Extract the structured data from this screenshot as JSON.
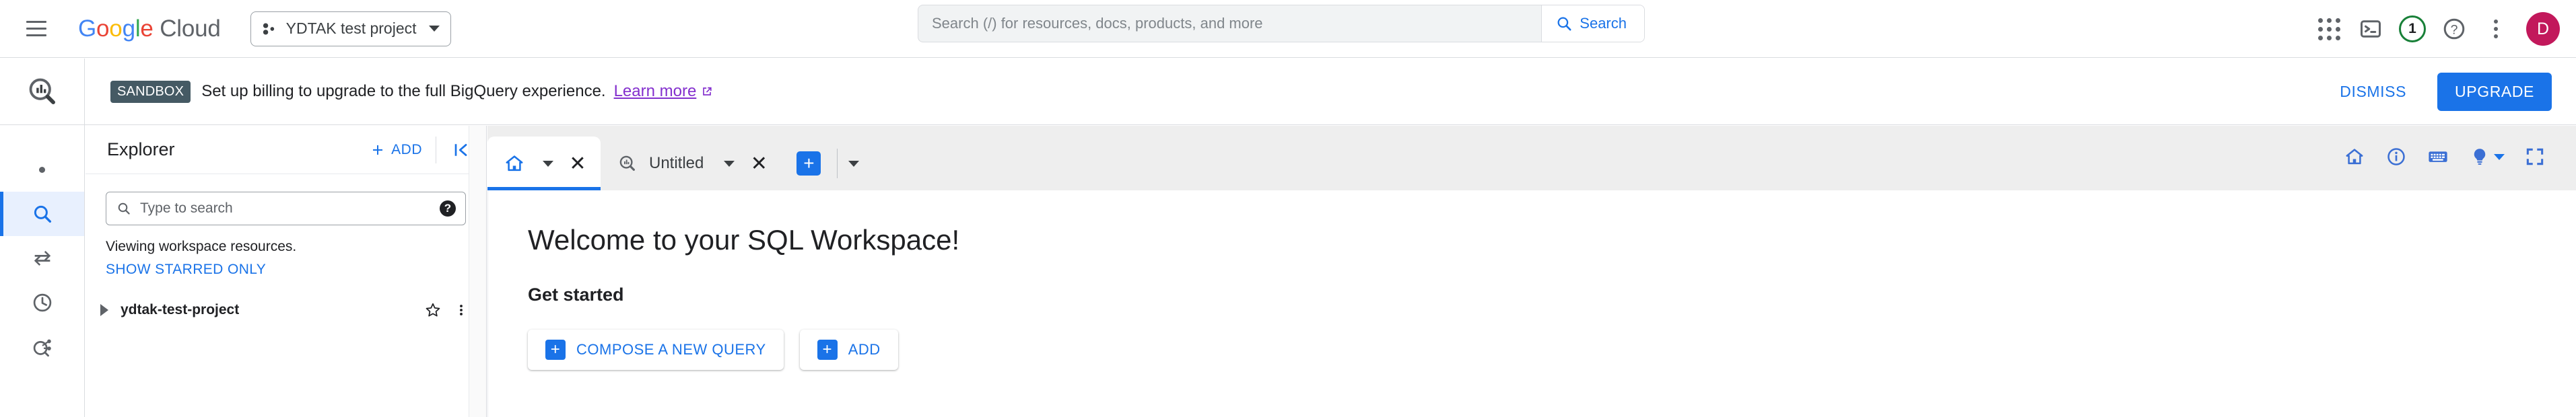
{
  "header": {
    "menu_icon": "hamburger-icon",
    "logo": {
      "google": "Google",
      "cloud": "Cloud"
    },
    "project_selector": {
      "label": "YDTAK test project",
      "icon": "project-nodes-icon",
      "caret": "chevron-down-icon"
    },
    "search": {
      "placeholder": "Search (/) for resources, docs, products, and more",
      "value": "",
      "button_label": "Search",
      "button_icon": "search-icon"
    },
    "icons": [
      {
        "name": "apps-grid-icon",
        "label": "Google apps"
      },
      {
        "name": "cloud-shell-icon",
        "label": "Activate Cloud Shell"
      },
      {
        "name": "notifications-badge-icon",
        "label": "1",
        "color": "#188038"
      },
      {
        "name": "help-icon",
        "label": "Help"
      },
      {
        "name": "more-options-icon",
        "label": "More options"
      }
    ],
    "avatar": {
      "initial": "D",
      "color": "#c2185b"
    }
  },
  "sandbox_bar": {
    "badge": "SANDBOX",
    "message": "Set up billing to upgrade to the full BigQuery experience.",
    "link_label": "Learn more",
    "link_icon": "external-link-icon",
    "dismiss_label": "DISMISS",
    "upgrade_label": "UPGRADE",
    "badge_color": "#455a64",
    "link_color": "#8430ce",
    "accent_color": "#1a73e8"
  },
  "left_rail": {
    "product_icon": "bigquery-logo-icon",
    "items": [
      {
        "name": "rail-item-dot",
        "icon": "dot-icon",
        "active": false
      },
      {
        "name": "rail-item-search",
        "icon": "search-icon",
        "active": true
      },
      {
        "name": "rail-item-transfers",
        "icon": "data-transfer-icon",
        "active": false
      },
      {
        "name": "rail-item-history",
        "icon": "clock-history-icon",
        "active": false
      },
      {
        "name": "rail-item-scheduled-queries",
        "icon": "scheduled-queries-icon",
        "active": false
      }
    ]
  },
  "explorer": {
    "title": "Explorer",
    "add_label": "ADD",
    "add_icon": "plus-icon",
    "collapse_icon": "collapse-panel-icon",
    "search": {
      "placeholder": "Type to search",
      "value": "",
      "icon": "search-icon",
      "help_icon": "help-icon"
    },
    "note": "Viewing workspace resources.",
    "starred_label": "SHOW STARRED ONLY",
    "tree": [
      {
        "label": "ydtak-test-project",
        "expand_icon": "triangle-right-icon",
        "star_icon": "star-outline-icon",
        "menu_icon": "more-vert-icon"
      }
    ]
  },
  "main": {
    "tabs": [
      {
        "name": "tab-home",
        "icon": "home-icon",
        "label": "",
        "active": true,
        "caret": "chevron-down-icon",
        "close": "close-icon"
      },
      {
        "name": "tab-untitled-query",
        "icon": "bigquery-logo-icon",
        "label": "Untitled",
        "active": false,
        "caret": "chevron-down-icon",
        "close": "close-icon"
      }
    ],
    "add_tab": {
      "icon": "plus-icon",
      "caret": "chevron-down-icon"
    },
    "toolbar_icons": [
      {
        "name": "toolbar-home-icon",
        "icon": "home-icon"
      },
      {
        "name": "toolbar-info-icon",
        "icon": "info-circle-icon"
      },
      {
        "name": "toolbar-keyboard-shortcuts-icon",
        "icon": "keyboard-icon"
      },
      {
        "name": "toolbar-tips-icon",
        "icon": "lightbulb-icon",
        "has_caret": true
      },
      {
        "name": "toolbar-fullscreen-icon",
        "icon": "fullscreen-icon"
      }
    ],
    "welcome_title": "Welcome to your SQL Workspace!",
    "get_started_title": "Get started",
    "actions": [
      {
        "name": "compose-new-query-button",
        "label": "COMPOSE A NEW QUERY",
        "icon": "plus-square-icon"
      },
      {
        "name": "add-data-button",
        "label": "ADD",
        "icon": "plus-square-icon"
      }
    ]
  }
}
